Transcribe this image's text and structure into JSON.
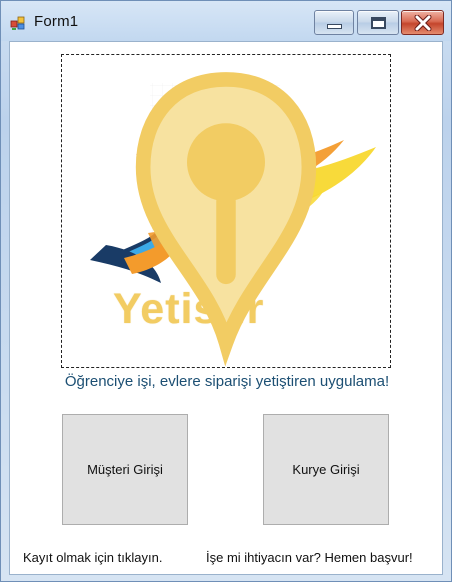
{
  "window": {
    "title": "Form1"
  },
  "titlebar_buttons": {
    "minimize": "minimize-icon",
    "maximize": "maximize-icon",
    "close": "close-icon"
  },
  "logo": {
    "brand_text": "Yetistir",
    "colors": {
      "runner_blue": "#3ca9e6",
      "runner_dark": "#193b66",
      "ribbon_red": "#e42828",
      "flame_yellow": "#f8d82f",
      "flame_orange": "#f39b2c",
      "brand_yellow": "#f2cc63"
    }
  },
  "main": {
    "slogan": "Öğrenciye işi, evlere siparişi yetiştiren uygulama!",
    "buttons": {
      "customer_login": "Müşteri Girişi",
      "courier_login": "Kurye Girişi"
    },
    "links": {
      "register": "Kayıt olmak için tıklayın.",
      "apply": "İşe mi ihtiyacın var? Hemen başvur!"
    }
  }
}
